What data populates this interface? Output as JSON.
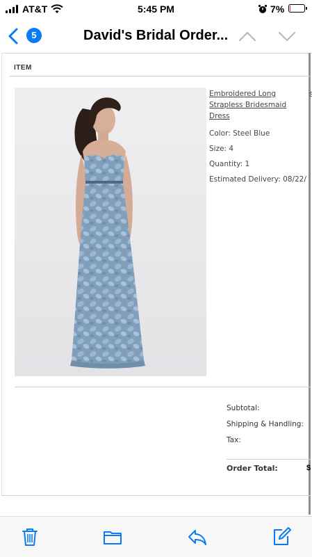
{
  "status_bar": {
    "carrier": "AT&T",
    "time": "5:45 PM",
    "battery_percent": "7%",
    "battery_level": 0.07
  },
  "nav": {
    "unread_count": "5",
    "title": "David's Bridal Order..."
  },
  "email": {
    "item_header": "ITEM",
    "product": {
      "name": "Embroidered Long Strapless Bridesmaid Dress",
      "color": "Color: Steel Blue",
      "size": "Size: 4",
      "quantity": "Quantity: 1",
      "delivery": "Estimated Delivery: 08/22/",
      "price_fragment": "S"
    },
    "totals": {
      "subtotal_label": "Subtotal:",
      "shipping_label": "Shipping & Handling:",
      "tax_label": "Tax:",
      "order_total_label": "Order Total:",
      "order_total_fragment": "$"
    }
  },
  "colors": {
    "accent": "#0a7af5",
    "dress": "#7f9fbd",
    "battery_low": "#e53935"
  },
  "icons": {
    "back": "chevron-left-icon",
    "previous": "chevron-up-icon",
    "next": "chevron-down-icon",
    "trash": "trash-icon",
    "folder": "folder-icon",
    "reply": "reply-icon",
    "compose": "compose-icon"
  }
}
